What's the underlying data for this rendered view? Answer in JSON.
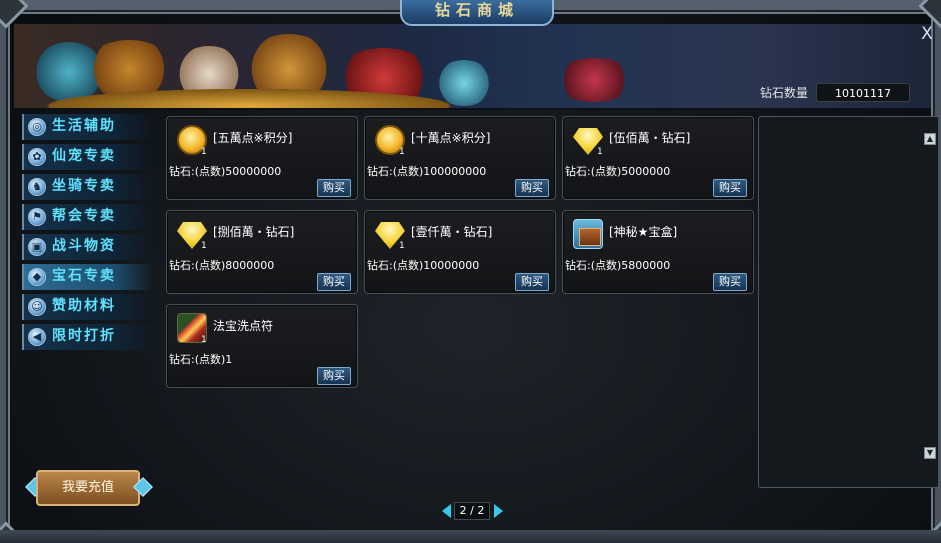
{
  "window": {
    "title": "钻石商城",
    "close_symbol": "X"
  },
  "balance": {
    "label": "钻石数量",
    "value": "10101117"
  },
  "sidebar": {
    "items": [
      {
        "label": "生活辅助",
        "icon": "compass-icon",
        "active": false
      },
      {
        "label": "仙宠专卖",
        "icon": "paw-icon",
        "active": false
      },
      {
        "label": "坐骑专卖",
        "icon": "horse-icon",
        "active": false
      },
      {
        "label": "帮会专卖",
        "icon": "flag-icon",
        "active": false
      },
      {
        "label": "战斗物资",
        "icon": "box-icon",
        "active": false
      },
      {
        "label": "宝石专卖",
        "icon": "gem-icon",
        "active": true
      },
      {
        "label": "赞助材料",
        "icon": "person-icon",
        "active": false
      },
      {
        "label": "限时打折",
        "icon": "horn-icon",
        "active": false
      }
    ],
    "recharge_label": "我要充值"
  },
  "items": [
    {
      "name": "[五萬点※积分]",
      "qty": "1",
      "price": "钻石:(点数)50000000",
      "buy_label": "购买",
      "icon": "coin-icon"
    },
    {
      "name": "[十萬点※积分]",
      "qty": "1",
      "price": "钻石:(点数)100000000",
      "buy_label": "购买",
      "icon": "coin-icon"
    },
    {
      "name": "[伍佰萬・钻石]",
      "qty": "1",
      "price": "钻石:(点数)5000000",
      "buy_label": "购买",
      "icon": "diamond-icon"
    },
    {
      "name": "[捌佰萬・钻石]",
      "qty": "1",
      "price": "钻石:(点数)8000000",
      "buy_label": "购买",
      "icon": "diamond-icon"
    },
    {
      "name": "[壹仟萬・钻石]",
      "qty": "1",
      "price": "钻石:(点数)10000000",
      "buy_label": "购买",
      "icon": "diamond-icon"
    },
    {
      "name": "[神秘★宝盒]",
      "qty": "",
      "price": "钻石:(点数)5800000",
      "buy_label": "购买",
      "icon": "treasure-chest-icon"
    },
    {
      "name": "法宝洗点符",
      "qty": "1",
      "price": "钻石:(点数)1",
      "buy_label": "购买",
      "icon": "talisman-icon"
    }
  ],
  "pager": {
    "text": "2 / 2",
    "current": 2,
    "total": 2
  },
  "colors": {
    "sidebar_text": "#5ee2ff",
    "accent": "#38c8ee",
    "button": "#2f5a80"
  }
}
